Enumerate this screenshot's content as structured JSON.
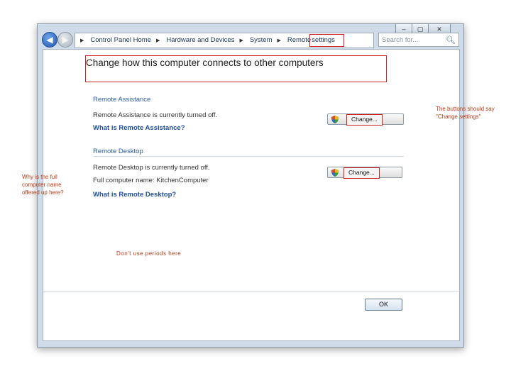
{
  "window": {
    "controls": [
      "–",
      "▢",
      "✕"
    ]
  },
  "nav": {
    "back_glyph": "◀",
    "forward_glyph": "▶"
  },
  "breadcrumb": {
    "items": [
      "Control Panel Home",
      "Hardware and Devices",
      "System",
      "Remote"
    ],
    "current": "settings",
    "separator": "▶"
  },
  "search": {
    "placeholder": "Search for...",
    "icon": "search-icon"
  },
  "page": {
    "title": "Change how this computer connects to other computers"
  },
  "remote_assistance": {
    "heading": "Remote Assistance",
    "status": "Remote Assistance is currently turned off.",
    "link": "What is Remote Assistance?",
    "button_label": "Change..."
  },
  "remote_desktop": {
    "heading": "Remote Desktop",
    "status": "Remote Desktop is currently turned off.",
    "computer_name_label": "Full computer name:",
    "computer_name": "KitchenComputer",
    "link": "What is Remote Desktop?",
    "button_label": "Change..."
  },
  "footer": {
    "ok_label": "OK"
  },
  "annotations": {
    "left": "Why is the full computer name offered up here?",
    "right": "The buttons should say \"Change settings\"",
    "periods": "Don't use periods here",
    "color": "#c03a15"
  },
  "colors": {
    "link": "#1f4f99",
    "heading": "#2b5da5",
    "highlight_box": "#cc2222"
  }
}
